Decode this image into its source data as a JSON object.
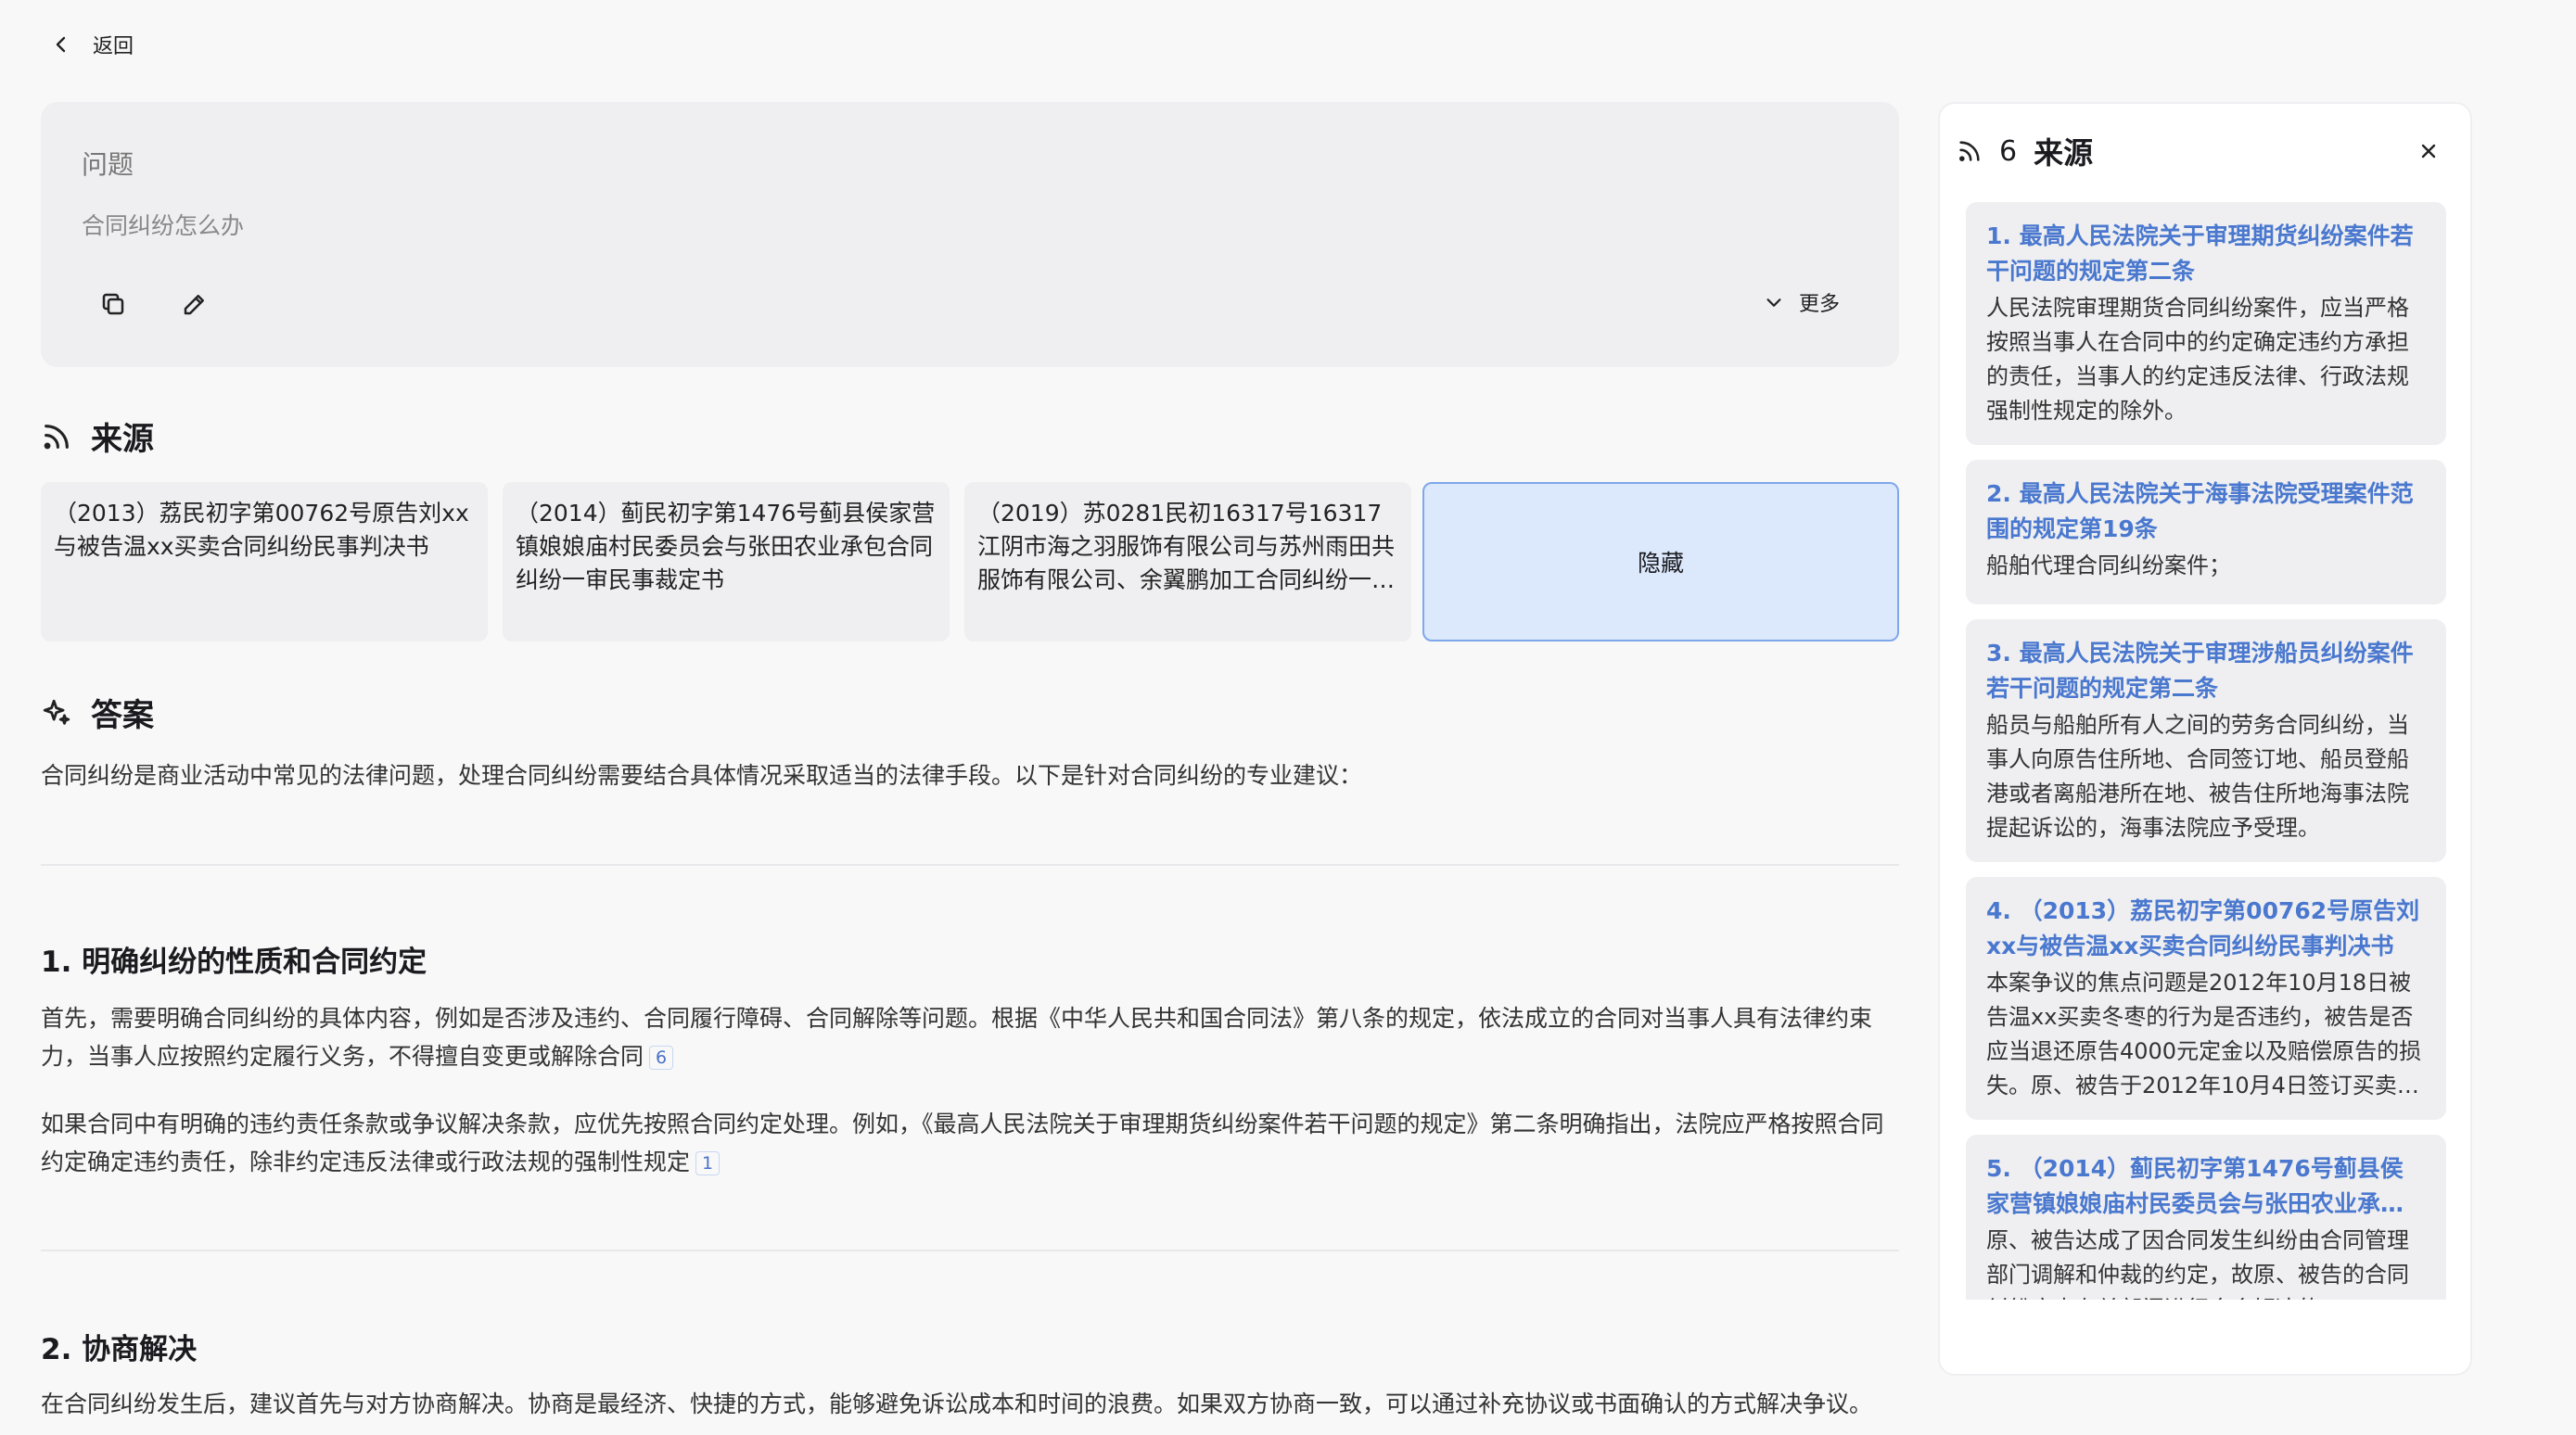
{
  "nav": {
    "back_label": "返回"
  },
  "question": {
    "title": "问题",
    "text": "合同纠纷怎么办",
    "more_label": "更多"
  },
  "sources_section": {
    "title": "来源",
    "cards": [
      {
        "text": "（2013）荔民初字第00762号原告刘xx与被告温xx买卖合同纠纷民事判决书"
      },
      {
        "text": "（2014）蓟民初字第1476号蓟县侯家营镇娘娘庙村民委员会与张田农业承包合同纠纷一审民事裁定书"
      },
      {
        "text": "（2019）苏0281民初16317号16317江阴市海之羽服饰有限公司与苏州雨田共服饰有限公司、余翼鹏加工合同纠纷一审民事判决书"
      }
    ],
    "hide_label": "隐藏"
  },
  "answer": {
    "title": "答案",
    "intro": "合同纠纷是商业活动中常见的法律问题，处理合同纠纷需要结合具体情况采取适当的法律手段。以下是针对合同纠纷的专业建议：",
    "s1_title": "1. 明确纠纷的性质和合同约定",
    "s1_p1": "首先，需要明确合同纠纷的具体内容，例如是否涉及违约、合同履行障碍、合同解除等问题。根据《中华人民共和国合同法》第八条的规定，依法成立的合同对当事人具有法律约束力，当事人应按照约定履行义务，不得擅自变更或解除合同",
    "s1_p1_cite": "6",
    "s1_p2": "如果合同中有明确的违约责任条款或争议解决条款，应优先按照合同约定处理。例如，《最高人民法院关于审理期货纠纷案件若干问题的规定》第二条明确指出，法院应严格按照合同约定确定违约责任，除非约定违反法律或行政法规的强制性规定",
    "s1_p2_cite": "1",
    "s2_title": "2. 协商解决",
    "s2_p1": "在合同纠纷发生后，建议首先与对方协商解决。协商是最经济、快捷的方式，能够避免诉讼成本和时间的浪费。如果双方协商一致，可以通过补充协议或书面确认的方式解决争议。"
  },
  "side_panel": {
    "count": "6",
    "title": "来源",
    "items": [
      {
        "title": "1. 最高人民法院关于审理期货纠纷案件若干问题的规定第二条",
        "body": "人民法院审理期货合同纠纷案件，应当严格按照当事人在合同中的约定确定违约方承担的责任，当事人的约定违反法律、行政法规强制性规定的除外。"
      },
      {
        "title": "2. 最高人民法院关于海事法院受理案件范围的规定第19条",
        "body": "船舶代理合同纠纷案件；"
      },
      {
        "title": "3. 最高人民法院关于审理涉船员纠纷案件若干问题的规定第二条",
        "body": "船员与船舶所有人之间的劳务合同纠纷，当事人向原告住所地、合同签订地、船员登船港或者离船港所在地、被告住所地海事法院提起诉讼的，海事法院应予受理。"
      },
      {
        "title": "4. （2013）荔民初字第00762号原告刘xx与被告温xx买卖合同纠纷民事判决书",
        "body": "本案争议的焦点问题是2012年10月18日被告温xx买卖冬枣的行为是否违约，被告是否应当退还原告4000元定金以及赔偿原告的损失。原、被告于2012年10月4日签订买卖冬枣合同"
      },
      {
        "title": "5. （2014）蓟民初字第1476号蓟县侯家营镇娘娘庙村民委员会与张田农业承包合同纠纷一审民事裁定书",
        "body": "原、被告达成了因合同发生纠纷由合同管理部门调解和仲裁的约定，故原、被告的合同纠纷应由有关部门进行合会解决的"
      }
    ]
  }
}
